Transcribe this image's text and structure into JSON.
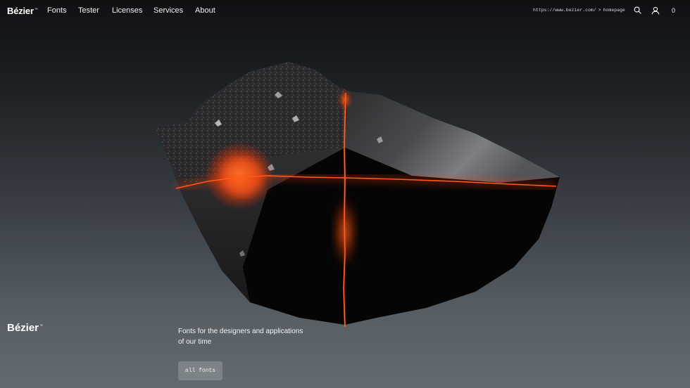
{
  "nav": {
    "logo": "Bézier",
    "logo_mark": "™",
    "links": [
      {
        "label": "Fonts"
      },
      {
        "label": "Tester"
      },
      {
        "label": "Licenses"
      },
      {
        "label": "Services"
      },
      {
        "label": "About"
      }
    ],
    "breadcrumb": {
      "url": "https://www.bezier.com/",
      "separator": ">",
      "page": "homepage"
    },
    "icons": {
      "search": "search-icon",
      "account": "user-icon"
    },
    "cart_count": "0"
  },
  "hero": {
    "logo": "Bézier",
    "logo_mark": "™",
    "tagline_line1": "Fonts for the designers and applications",
    "tagline_line2": "of our time",
    "cta_label": "all fonts"
  },
  "colors": {
    "glow": "#ff3b0f",
    "glow_core": "#ff7a2a",
    "rock_dark": "#0a0a0a",
    "rock_surface": "#3a3a3a"
  }
}
